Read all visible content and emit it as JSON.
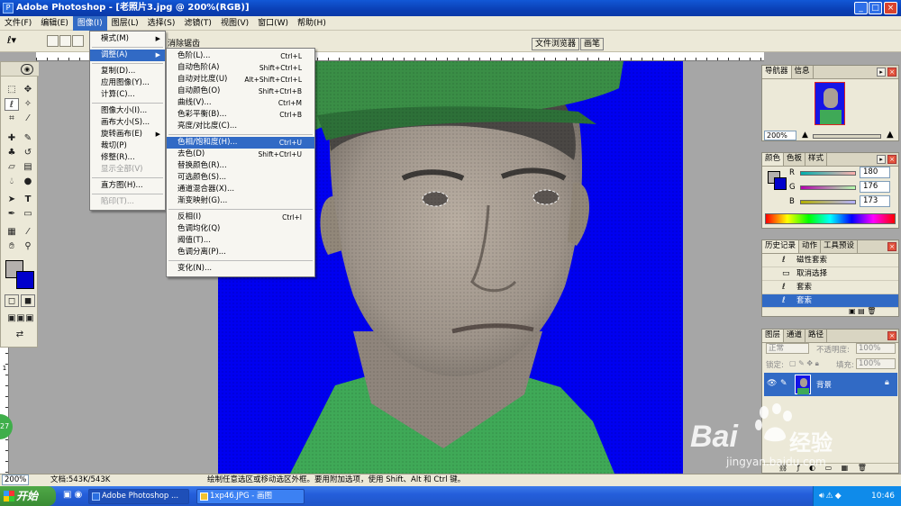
{
  "window": {
    "title": "Adobe Photoshop - [老照片3.jpg @ 200%(RGB)]",
    "controls": [
      "_",
      "□",
      "×"
    ]
  },
  "menubar": {
    "items": [
      "文件(F)",
      "编辑(E)",
      "图像(I)",
      "图层(L)",
      "选择(S)",
      "滤镜(T)",
      "视图(V)",
      "窗口(W)",
      "帮助(H)"
    ]
  },
  "options": {
    "antialias_label": "消除锯齿"
  },
  "palette_well": {
    "tabs": [
      "文件浏览器",
      "画笔"
    ]
  },
  "image_menu": {
    "groups": [
      [
        {
          "label": "模式(M)",
          "arrow": "▶"
        },
        {
          "label": "调整(A)",
          "arrow": "▶",
          "highlighted": true
        }
      ],
      [
        {
          "label": "复制(D)..."
        },
        {
          "label": "应用图像(Y)..."
        },
        {
          "label": "计算(C)..."
        }
      ],
      [
        {
          "label": "图像大小(I)..."
        },
        {
          "label": "画布大小(S)..."
        },
        {
          "label": "旋转画布(E)",
          "arrow": "▶"
        },
        {
          "label": "裁切(P)"
        },
        {
          "label": "修整(R)..."
        },
        {
          "label": "显示全部(V)",
          "disabled": true
        }
      ],
      [
        {
          "label": "直方图(H)..."
        }
      ],
      [
        {
          "label": "陷印(T)...",
          "disabled": true
        }
      ]
    ]
  },
  "adjust_menu": {
    "groups": [
      [
        {
          "label": "色阶(L)...",
          "shortcut": "Ctrl+L"
        },
        {
          "label": "自动色阶(A)",
          "shortcut": "Shift+Ctrl+L"
        },
        {
          "label": "自动对比度(U)",
          "shortcut": "Alt+Shift+Ctrl+L"
        },
        {
          "label": "自动颜色(O)",
          "shortcut": "Shift+Ctrl+B"
        },
        {
          "label": "曲线(V)...",
          "shortcut": "Ctrl+M"
        },
        {
          "label": "色彩平衡(B)...",
          "shortcut": "Ctrl+B"
        },
        {
          "label": "亮度/对比度(C)...",
          "shortcut": ""
        }
      ],
      [
        {
          "label": "色相/饱和度(H)...",
          "shortcut": "Ctrl+U",
          "highlighted": true
        },
        {
          "label": "去色(D)",
          "shortcut": "Shift+Ctrl+U"
        },
        {
          "label": "替换颜色(R)...",
          "shortcut": ""
        },
        {
          "label": "可选颜色(S)...",
          "shortcut": ""
        },
        {
          "label": "通道混合器(X)...",
          "shortcut": ""
        },
        {
          "label": "渐变映射(G)...",
          "shortcut": ""
        }
      ],
      [
        {
          "label": "反相(I)",
          "shortcut": "Ctrl+I"
        },
        {
          "label": "色调均化(Q)",
          "shortcut": ""
        },
        {
          "label": "阈值(T)...",
          "shortcut": ""
        },
        {
          "label": "色调分离(P)...",
          "shortcut": ""
        }
      ],
      [
        {
          "label": "变化(N)...",
          "shortcut": ""
        }
      ]
    ]
  },
  "navigator": {
    "tabs": [
      "导航器",
      "信息"
    ],
    "zoom": "200%"
  },
  "color_panel": {
    "tabs": [
      "颜色",
      "色板",
      "样式"
    ],
    "channels": [
      {
        "label": "R",
        "value": "180"
      },
      {
        "label": "G",
        "value": "176"
      },
      {
        "label": "B",
        "value": "173"
      }
    ]
  },
  "history": {
    "tabs": [
      "历史记录",
      "动作",
      "工具预设"
    ],
    "items": [
      {
        "label": "磁性套索"
      },
      {
        "label": "取消选择"
      },
      {
        "label": "套索"
      },
      {
        "label": "套索",
        "selected": true
      }
    ]
  },
  "layers": {
    "tabs": [
      "图层",
      "通道",
      "路径"
    ],
    "blend_mode": "正常",
    "opacity_label": "不透明度:",
    "opacity": "100%",
    "lock_label": "锁定:",
    "fill_label": "填充:",
    "fill": "100%",
    "layer_name": "背景"
  },
  "status": {
    "zoom": "200%",
    "doc": "文档:543K/543K",
    "hint": "绘制任意选区或移动选区外框。要用附加选项，使用 Shift、Alt 和 Ctrl 键。"
  },
  "ruler": {
    "left_mark": "1"
  },
  "taskbar": {
    "start": "开始",
    "tasks": [
      "Adobe Photoshop ...",
      "1xp46.JPG - 画图"
    ],
    "clock": "10:46"
  },
  "watermark": {
    "brand": "Bai",
    "brand2": "经验",
    "url": "jingyan.baidu.com"
  },
  "colors": {
    "canvas_bg": "#0000f0",
    "menu_highlight": "#316ac5",
    "titlebar": "#0a3fb5"
  }
}
